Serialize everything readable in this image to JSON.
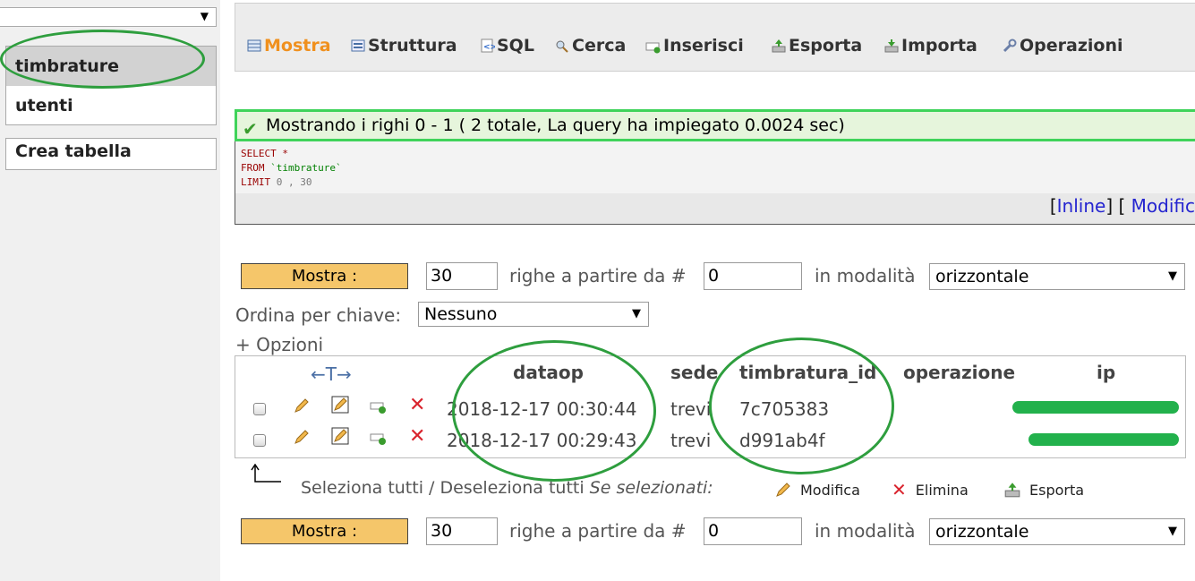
{
  "sidebar": {
    "db_select_value": "",
    "tables": [
      {
        "label": "timbrature",
        "selected": true
      },
      {
        "label": "utenti",
        "selected": false
      }
    ],
    "create_table": "Crea tabella"
  },
  "tabs": [
    {
      "label": "Mostra",
      "icon": "browse-icon",
      "active": true
    },
    {
      "label": "Struttura",
      "icon": "structure-icon"
    },
    {
      "label": "SQL",
      "icon": "sql-icon"
    },
    {
      "label": "Cerca",
      "icon": "search-icon"
    },
    {
      "label": "Inserisci",
      "icon": "insert-icon"
    },
    {
      "label": "Esporta",
      "icon": "export-icon"
    },
    {
      "label": "Importa",
      "icon": "import-icon"
    },
    {
      "label": "Operazioni",
      "icon": "operations-icon"
    }
  ],
  "message": "Mostrando i righi 0 - 1 ( 2 totale, La query ha impiegato 0.0024 sec)",
  "sql": {
    "line1_kw": "SELECT",
    "line1_rest": "*",
    "line2_kw": "FROM",
    "line2_rest": "`timbrature`",
    "line3_kw": "LIMIT",
    "line3_rest": "0 , 30",
    "links": {
      "inline": "Inline",
      "modify": "Modific"
    }
  },
  "nav": {
    "show_label": "Mostra :",
    "rows_value": "30",
    "rows_text": "righe a partire da #",
    "start_value": "0",
    "mode_text": "in modalità",
    "mode_value": "orizzontale"
  },
  "sort": {
    "label": "Ordina per chiave:",
    "value": "Nessuno"
  },
  "options_label": "+ Opzioni",
  "table": {
    "columns": [
      "dataop",
      "sede",
      "timbratura_id",
      "operazione",
      "ip"
    ],
    "rows": [
      {
        "dataop": "2018-12-17 00:30:44",
        "sede": "trevi",
        "timbratura_id": "7c705383",
        "operazione": "",
        "ip": ""
      },
      {
        "dataop": "2018-12-17 00:29:43",
        "sede": "trevi",
        "timbratura_id": "d991ab4f",
        "operazione": "",
        "ip": ""
      }
    ]
  },
  "footer": {
    "select_text": "Seleziona tutti / Deseleziona tutti",
    "if_selected": "Se selezionati:",
    "actions": [
      "Modifica",
      "Elimina",
      "Esporta"
    ]
  },
  "colors": {
    "accent": "#f0901e",
    "annotation_green": "#2e9e3e",
    "button": "#f5c66a",
    "success_border": "#3fd35a"
  }
}
